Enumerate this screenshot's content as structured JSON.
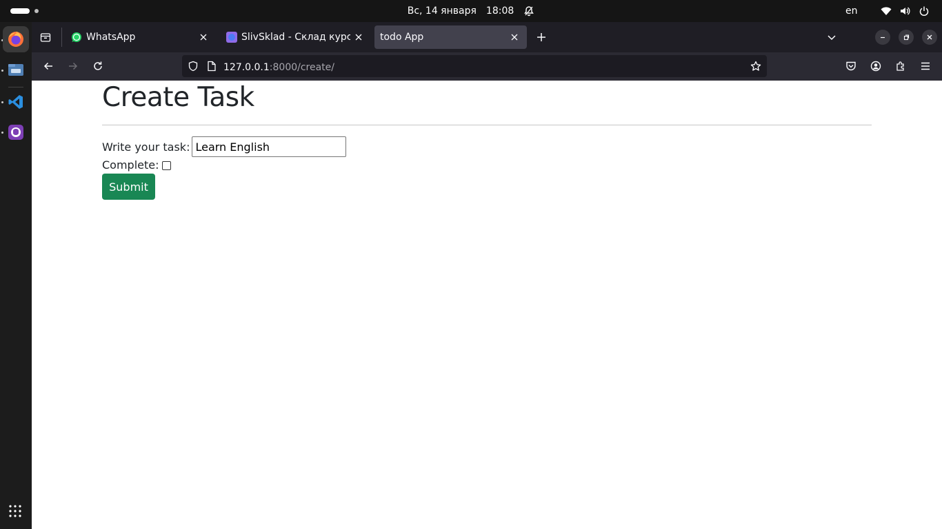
{
  "topbar": {
    "date": "Вс, 14 января",
    "time": "18:08",
    "keyboard_layout": "en",
    "icons": [
      "activities-indicator",
      "notification-bell-icon",
      "wifi-icon",
      "volume-icon",
      "power-icon"
    ]
  },
  "dock": {
    "apps": [
      {
        "name": "firefox-icon",
        "active": true
      },
      {
        "name": "files-icon",
        "active": false
      },
      {
        "name": "vscode-icon",
        "active": false
      },
      {
        "name": "github-desktop-icon",
        "active": false
      }
    ],
    "show_apps_icon": "grid-icon"
  },
  "tabs": [
    {
      "title": "WhatsApp",
      "icon": "whatsapp-icon",
      "selected": false
    },
    {
      "title": "SlivSklad - Склад курсов, ",
      "icon": "slivsklad-icon",
      "selected": false
    },
    {
      "title": "todo App",
      "icon": "",
      "selected": true
    }
  ],
  "navbar": {
    "url_host": "127.0.0.1",
    "url_path": ":8000/create/"
  },
  "page": {
    "title": "Create Task",
    "task_label": "Write your task:",
    "task_value": "Learn English",
    "complete_label": "Complete:",
    "complete_checked": false,
    "submit_label": "Submit"
  },
  "colors": {
    "submit_bg": "#198754",
    "tab_selected_bg": "#42414d",
    "urlbar_bg": "#1c1b22",
    "toolbar_bg": "#2b2a33"
  }
}
